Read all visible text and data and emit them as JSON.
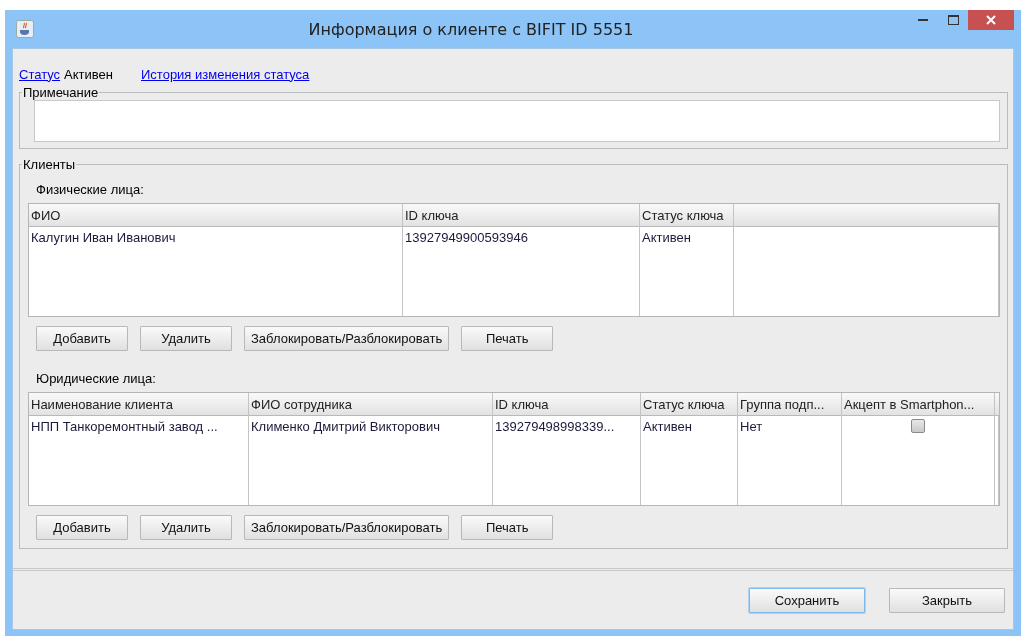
{
  "window": {
    "title": "Информация о клиенте с BIFIT ID 5551"
  },
  "status": {
    "link": "Статус",
    "value": "Активен",
    "history_link": "История изменения статуса"
  },
  "note": {
    "title": "Примечание"
  },
  "clients": {
    "title": "Клиенты",
    "tables": [
      {
        "title": "Физические лица:",
        "columns": [
          "ФИО",
          "ID ключа",
          "Статус ключа"
        ],
        "rows": [
          [
            {
              "text": "Калугин Иван Иванович"
            },
            {
              "text": "13927949900593946"
            },
            {
              "text": "Активен"
            }
          ]
        ],
        "buttons": [
          "Добавить",
          "Удалить",
          "Заблокировать/Разблокировать",
          "Печать"
        ]
      },
      {
        "title": "Юридические лица:",
        "columns": [
          "Наименование клиента",
          "ФИО сотрудника",
          "ID ключа",
          "Статус ключа",
          "Группа подп...",
          "Акцепт в Smartphon..."
        ],
        "rows": [
          [
            {
              "text": "НПП Танкоремонтный завод ..."
            },
            {
              "text": "Клименко Дмитрий Викторович"
            },
            {
              "text": "139279498998339..."
            },
            {
              "text": "Активен"
            },
            {
              "text": "Нет"
            },
            {
              "checked": false
            }
          ]
        ],
        "buttons": [
          "Добавить",
          "Удалить",
          "Заблокировать/Разблокировать",
          "Печать"
        ]
      }
    ]
  },
  "footer_buttons": [
    {
      "label": "Сохранить",
      "focused": true
    },
    {
      "label": "Закрыть",
      "focused": false
    }
  ]
}
